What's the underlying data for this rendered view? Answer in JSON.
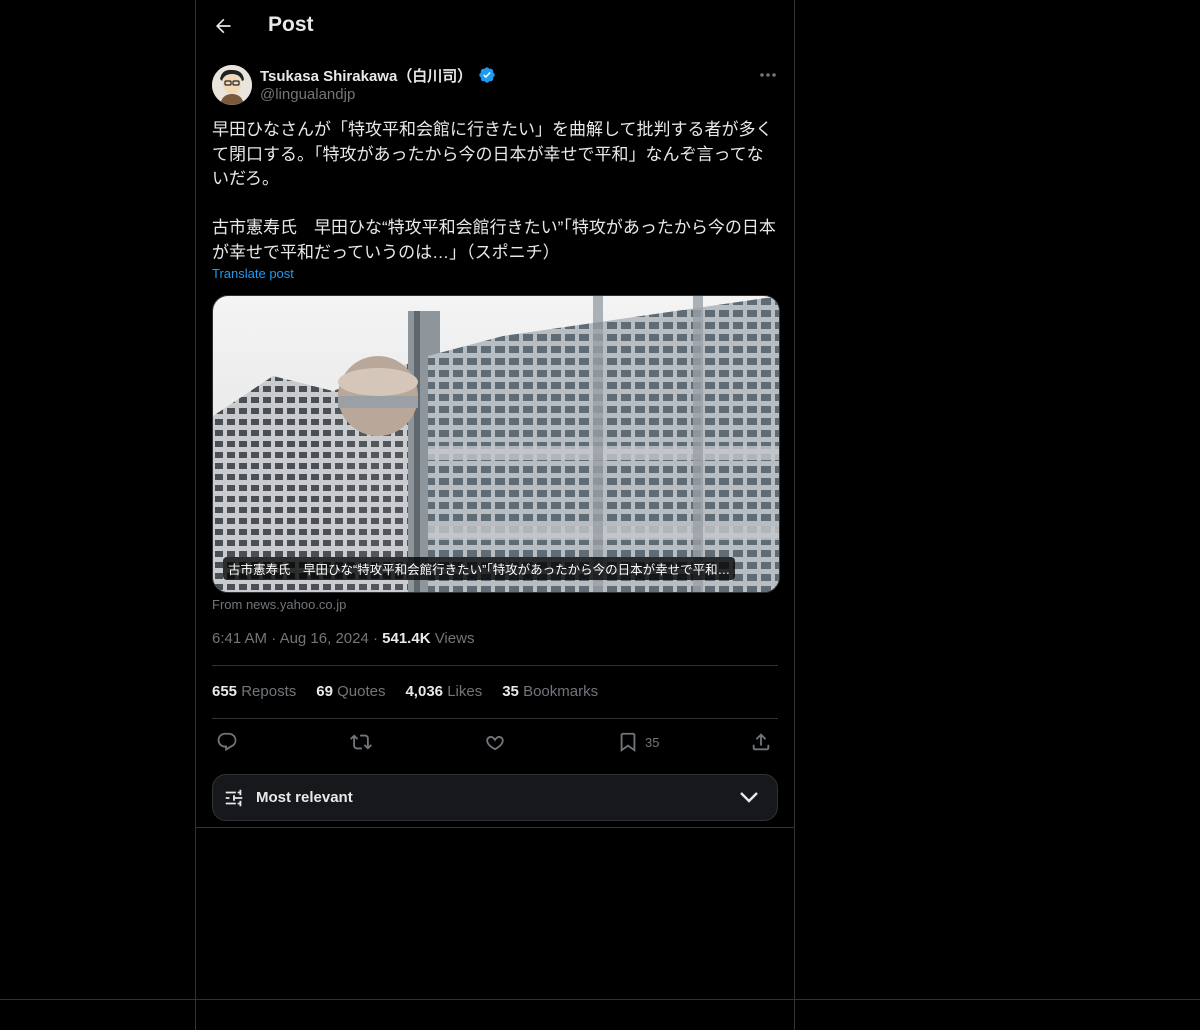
{
  "header": {
    "title": "Post"
  },
  "author": {
    "name": "Tsukasa Shirakawa（白川司）",
    "handle": "@lingualandjp"
  },
  "post": {
    "text": "早田ひなさんが「特攻平和会館に行きたい」を曲解して批判する者が多くて閉口する。「特攻があったから今の日本が幸せで平和」なんぞ言ってないだろ。\n\n古市憲寿氏　早田ひな“特攻平和会館行きたい”「特攻があったから今の日本が幸せで平和だっていうのは…」（スポニチ）",
    "translate_label": "Translate post",
    "card_caption": "古市憲寿氏　早田ひな“特攻平和会館行きたい”「特攻があったから今の日本が幸せで平和…",
    "card_source": "From news.yahoo.co.jp",
    "time": "6:41 AM",
    "date": "Aug 16, 2024",
    "views_count": "541.4K",
    "views_label": "Views"
  },
  "stats": {
    "reposts_count": "655",
    "reposts_label": "Reposts",
    "quotes_count": "69",
    "quotes_label": "Quotes",
    "likes_count": "4,036",
    "likes_label": "Likes",
    "bookmarks_count": "35",
    "bookmarks_label": "Bookmarks"
  },
  "actions": {
    "bookmark_count": "35"
  },
  "sort": {
    "label": "Most relevant"
  },
  "colors": {
    "accent": "#1d9bf0",
    "background": "#000000",
    "muted": "#71767b",
    "border": "#2f3336"
  },
  "icons": [
    "back-arrow-icon",
    "verified-badge-icon",
    "more-icon",
    "reply-icon",
    "repost-icon",
    "like-icon",
    "bookmark-icon",
    "share-icon",
    "sliders-icon",
    "chevron-down-icon"
  ]
}
